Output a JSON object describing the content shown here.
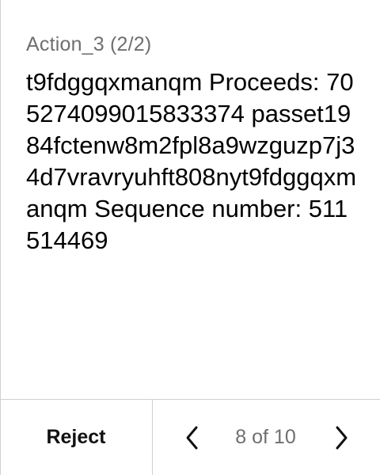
{
  "action": {
    "title": "Action_3 (2/2)",
    "message": "t9fdggqxmanqm Proceeds: 705274099015833374 passet1984fctenw8m2fpl8a9wzguzp7j34d7vravryuhft808nyt9fdggqxmanqm Sequence number: 511514469"
  },
  "footer": {
    "reject_label": "Reject",
    "pagination": "8 of 10",
    "prev_icon": "chevron-left-icon",
    "next_icon": "chevron-right-icon"
  }
}
